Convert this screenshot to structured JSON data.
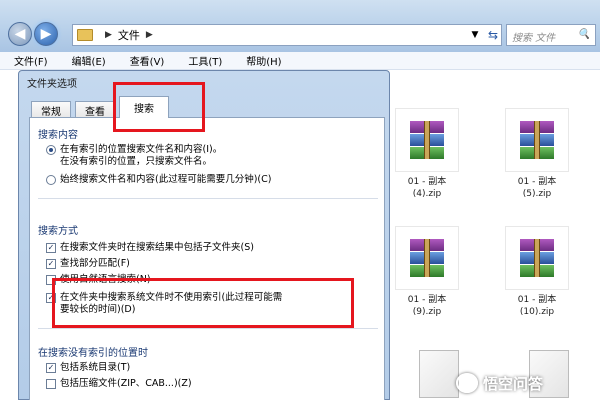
{
  "window": {
    "address_path": "文件",
    "search_placeholder": "搜索 文件",
    "search_icon_glyph": "🔍"
  },
  "menubar": [
    "文件(F)",
    "编辑(E)",
    "查看(V)",
    "工具(T)",
    "帮助(H)"
  ],
  "files": [
    {
      "label1": "01 - 副本",
      "label2": "(4).zip"
    },
    {
      "label1": "01 - 副本",
      "label2": "(5).zip"
    },
    {
      "label1": "01 - 副本",
      "label2": "(9).zip"
    },
    {
      "label1": "01 - 副本",
      "label2": "(10).zip"
    }
  ],
  "dialog": {
    "title": "文件夹选项",
    "tabs": [
      "常规",
      "查看",
      "搜索"
    ],
    "group_content": {
      "title": "搜索内容",
      "radio1_line1": "在有索引的位置搜索文件名和内容(I)。",
      "radio1_line2": "在没有索引的位置，只搜索文件名。",
      "radio2": "始终搜索文件名和内容(此过程可能需要几分钟)(C)"
    },
    "group_method": {
      "title": "搜索方式",
      "opt1": "在搜索文件夹时在搜索结果中包括子文件夹(S)",
      "opt2": "查找部分匹配(F)",
      "opt3": "使用自然语言搜索(N)",
      "opt4_line1": "在文件夹中搜索系统文件时不使用索引(此过程可能需",
      "opt4_line2": "要较长的时间)(D)"
    },
    "group_noindex": {
      "title": "在搜索没有索引的位置时",
      "opt1": "包括系统目录(T)",
      "opt2": "包括压缩文件(ZIP、CAB...)(Z)"
    }
  },
  "watermark": "悟空问答",
  "colors": {
    "highlight": "#e5161e"
  }
}
